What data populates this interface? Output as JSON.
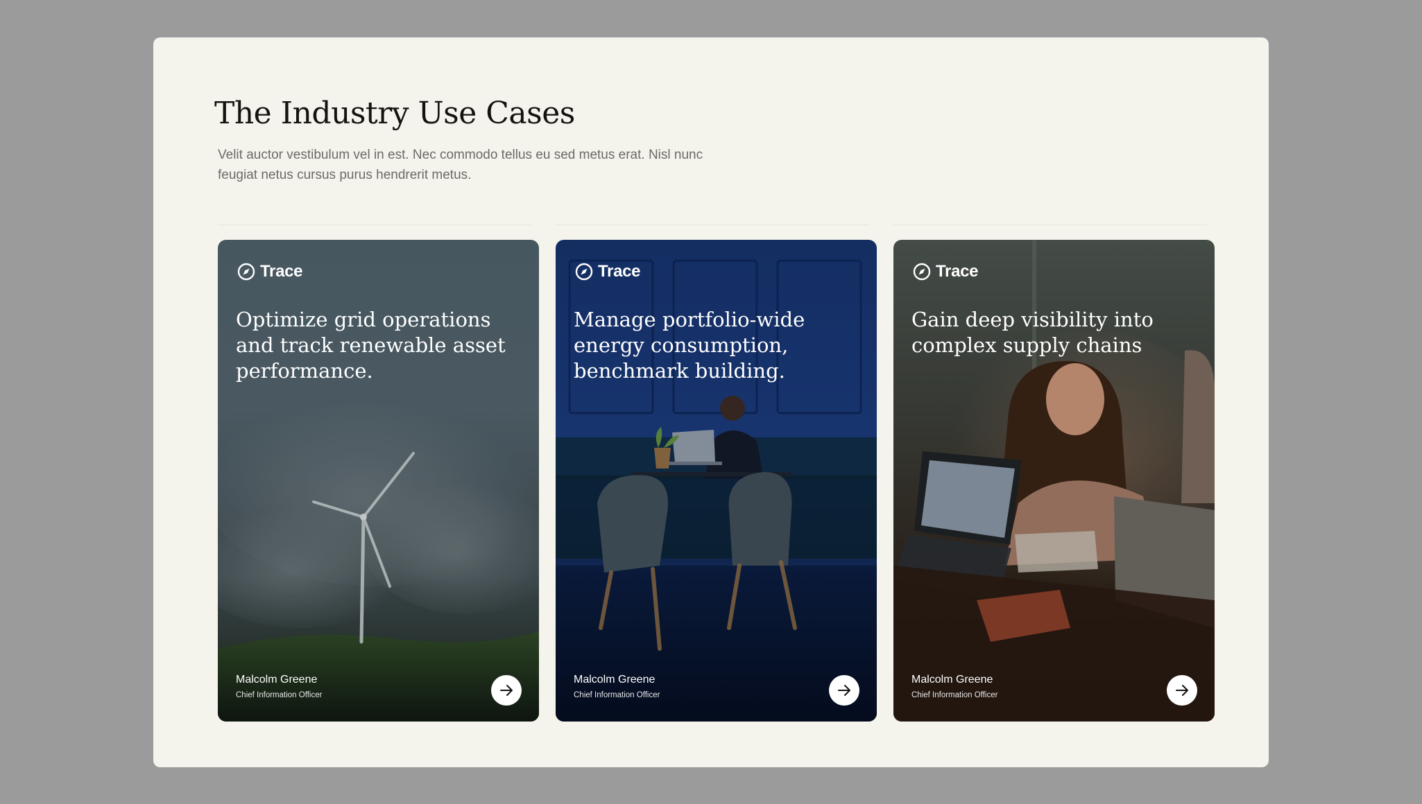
{
  "section": {
    "title": "The Industry Use Cases",
    "subtitle": "Velit auctor vestibulum vel in est. Nec commodo tellus eu sed metus erat. Nisl nunc feugiat netus cursus purus hendrerit metus."
  },
  "cards": [
    {
      "brand": "Trace",
      "headline": "Optimize grid operations and track renewable asset performance.",
      "person_name": "Malcolm Greene",
      "person_role": "Chief Information Officer",
      "arrow_icon": "arrow-right-icon",
      "theme": "wind-turbine"
    },
    {
      "brand": "Trace",
      "headline": "Manage portfolio-wide energy consumption, benchmark building.",
      "person_name": "Malcolm Greene",
      "person_role": "Chief Information Officer",
      "arrow_icon": "arrow-right-icon",
      "theme": "office-blue"
    },
    {
      "brand": "Trace",
      "headline": "Gain deep visibility into complex supply chains",
      "person_name": "Malcolm Greene",
      "person_role": "Chief Information Officer",
      "arrow_icon": "arrow-right-icon",
      "theme": "team-meeting"
    }
  ],
  "colors": {
    "page_bg": "#9b9b9b",
    "panel_bg": "#f4f4ec",
    "title": "#16130f",
    "subtitle": "#6d6a66",
    "card_text": "#ffffff"
  }
}
